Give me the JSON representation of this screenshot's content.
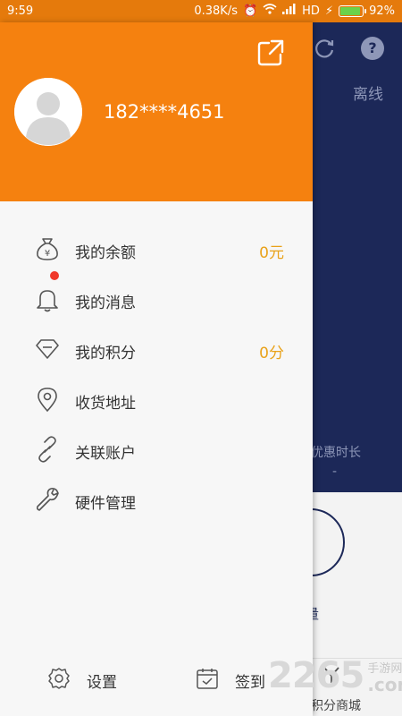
{
  "status_bar": {
    "time": "9:59",
    "net_speed": "0.38K/s",
    "network": "HD",
    "battery": "92%",
    "battery_level": 0.92,
    "battery_color": "#6ad24a"
  },
  "background_app": {
    "refresh_icon": "refresh-icon",
    "help_icon_glyph": "?",
    "offline_label": "离线",
    "discount_time_label": "优惠时长",
    "discount_time_value": "-",
    "quantity_label": "量",
    "shop_label": "积分商城"
  },
  "drawer": {
    "accent_color": "#f5810f",
    "phone": "182****4651",
    "share_icon": "external-share-icon",
    "avatar_icon": "user-avatar-icon",
    "menu": [
      {
        "label": "我的余额",
        "value": "0元",
        "icon": "money-bag-icon"
      },
      {
        "label": "我的消息",
        "value": "",
        "icon": "bell-icon",
        "badge": true
      },
      {
        "label": "我的积分",
        "value": "0分",
        "icon": "diamond-icon"
      },
      {
        "label": "收货地址",
        "value": "",
        "icon": "location-pin-icon"
      },
      {
        "label": "关联账户",
        "value": "",
        "icon": "link-icon"
      },
      {
        "label": "硬件管理",
        "value": "",
        "icon": "wrench-icon"
      }
    ],
    "footer": {
      "settings_label": "设置",
      "checkin_label": "签到"
    }
  },
  "watermark": {
    "number": "2265",
    "cn": "手游网",
    "en": ".com"
  }
}
